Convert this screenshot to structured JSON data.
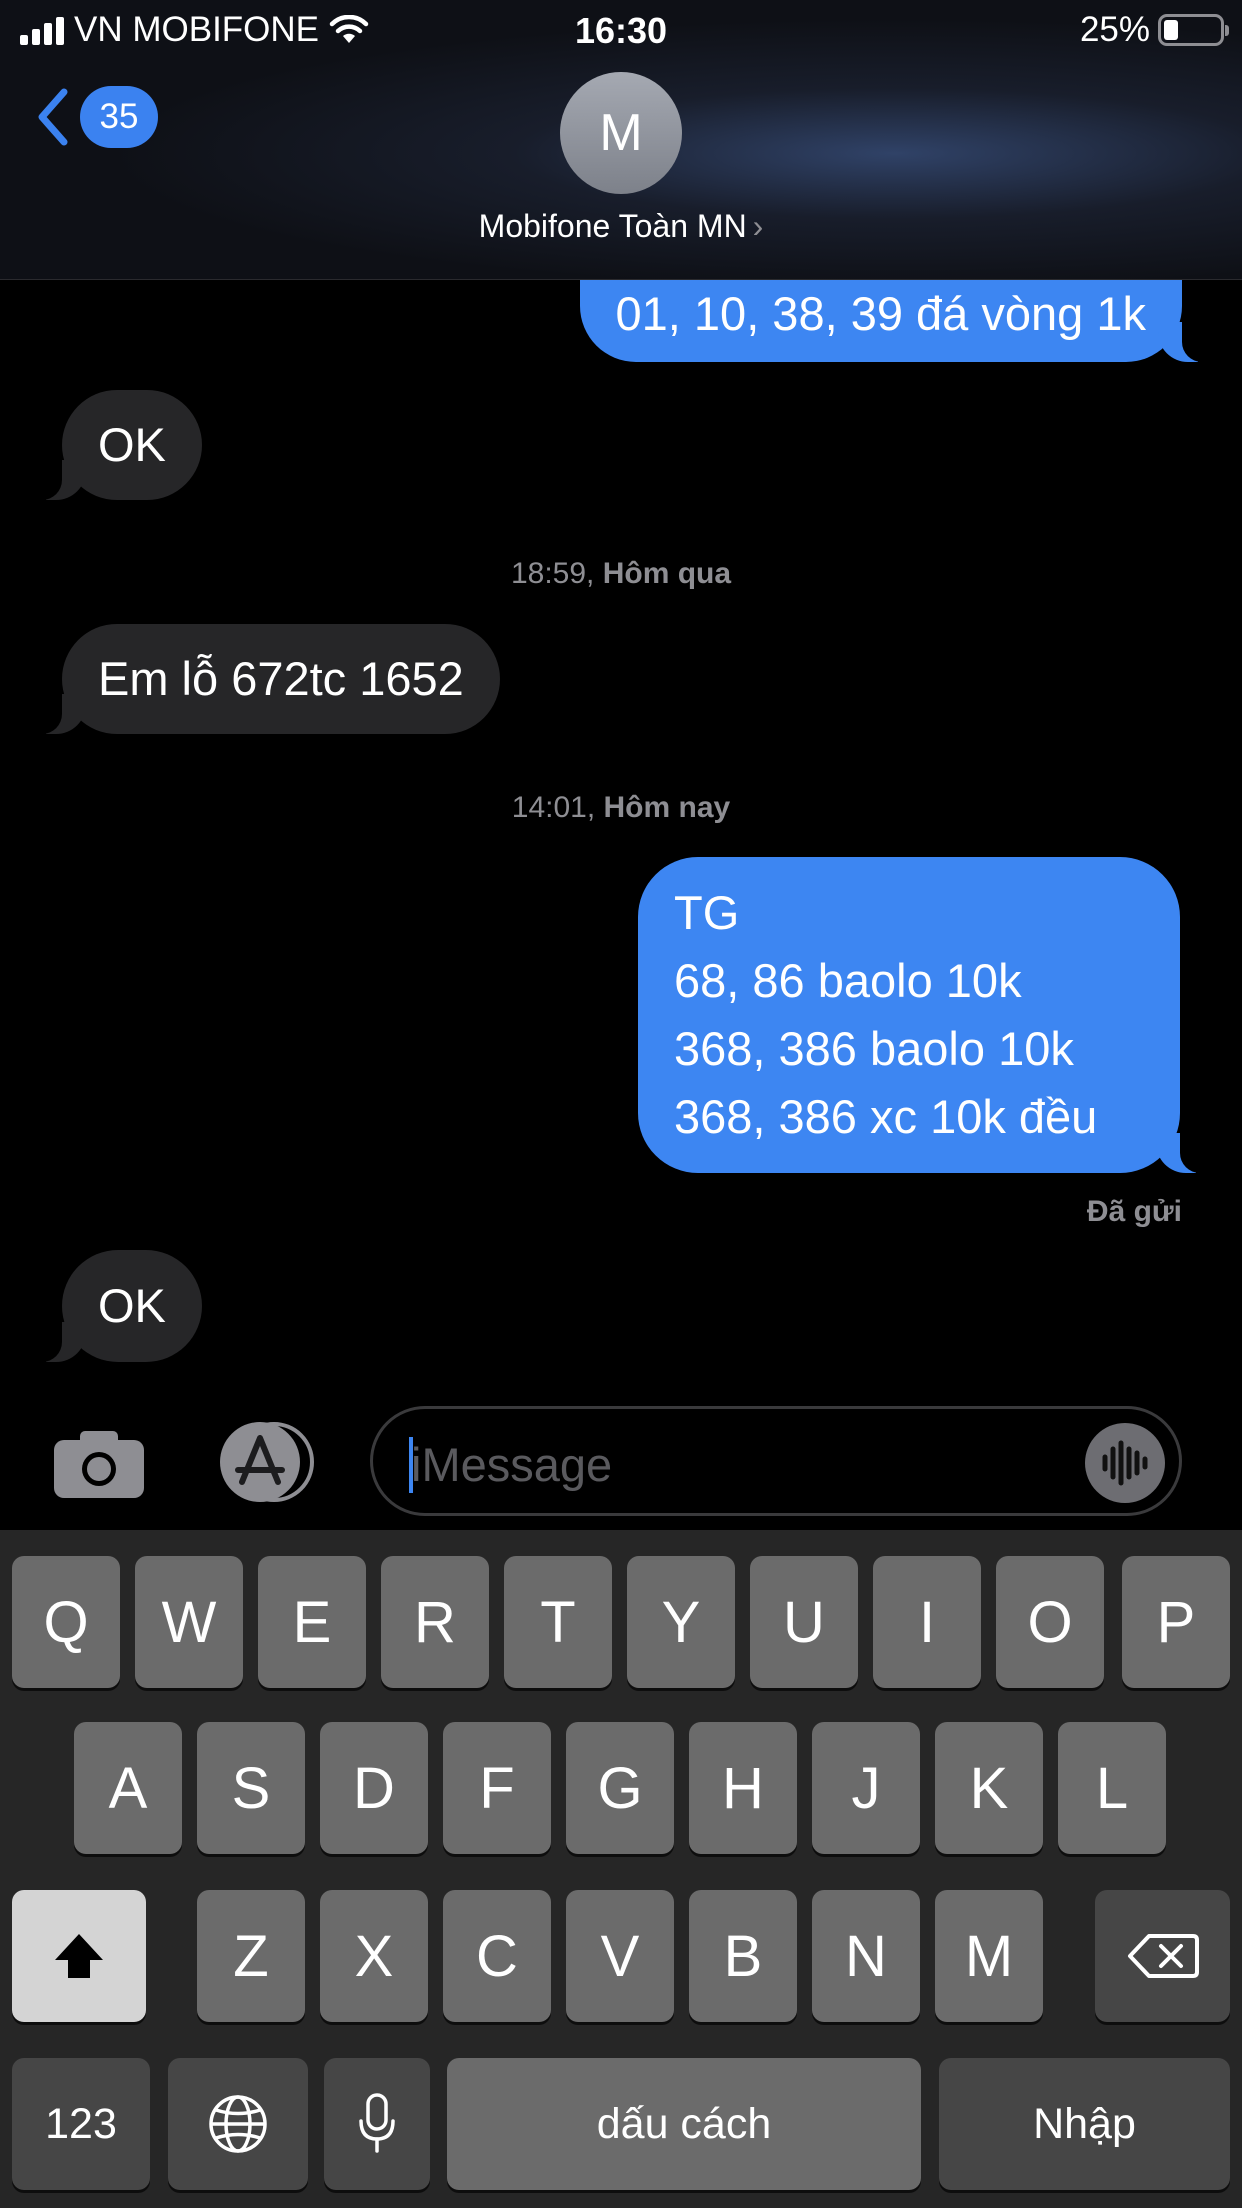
{
  "status_bar": {
    "carrier": "VN MOBIFONE",
    "time": "16:30",
    "battery": "25%"
  },
  "header": {
    "back_count": "35",
    "avatar_initial": "M",
    "contact_name": "Mobifone Toàn MN",
    "chevron": "›"
  },
  "messages": {
    "m1": "01, 10, 38, 39 đá vòng 1k",
    "m2": "OK",
    "ts1_time": "18:59, ",
    "ts1_day": "Hôm qua",
    "m3": "Em lỗ 672tc 1652",
    "ts2_time": "14:01, ",
    "ts2_day": "Hôm nay",
    "m4_lines": [
      "TG",
      "68, 86 baolo 10k",
      "368, 386 baolo 10k",
      "368, 386 xc 10k đều"
    ],
    "delivered": "Đã gửi",
    "m5": "OK"
  },
  "input": {
    "placeholder": "iMessage"
  },
  "keyboard": {
    "row1": [
      "Q",
      "W",
      "E",
      "R",
      "T",
      "Y",
      "U",
      "I",
      "O",
      "P"
    ],
    "row2": [
      "A",
      "S",
      "D",
      "F",
      "G",
      "H",
      "J",
      "K",
      "L"
    ],
    "row3": [
      "Z",
      "X",
      "C",
      "V",
      "B",
      "N",
      "M"
    ],
    "numbers_key": "123",
    "space_key": "dấu cách",
    "return_key": "Nhập"
  },
  "colors": {
    "bubble_out": "#3d86f2",
    "bubble_in": "#262628",
    "accent": "#3b82f0"
  }
}
